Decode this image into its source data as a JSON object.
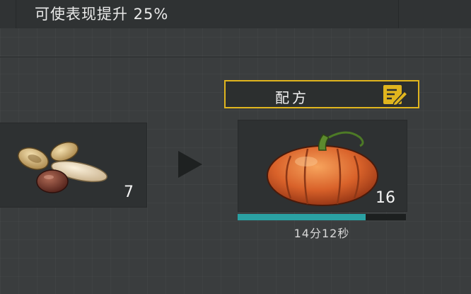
{
  "bonus": {
    "text": "可使表现提升 25%"
  },
  "recipe": {
    "label": "配方",
    "icon": "recipe-edit-icon",
    "accent": "#e0b51e"
  },
  "input_slot": {
    "item_icon": "seeds-icon",
    "count": "7"
  },
  "output_slot": {
    "item_icon": "pumpkin-icon",
    "count": "16"
  },
  "progress": {
    "fraction": 0.76,
    "timer": "14分12秒",
    "color": "#2aa1a3"
  },
  "transform_arrow": "play-arrow-icon"
}
